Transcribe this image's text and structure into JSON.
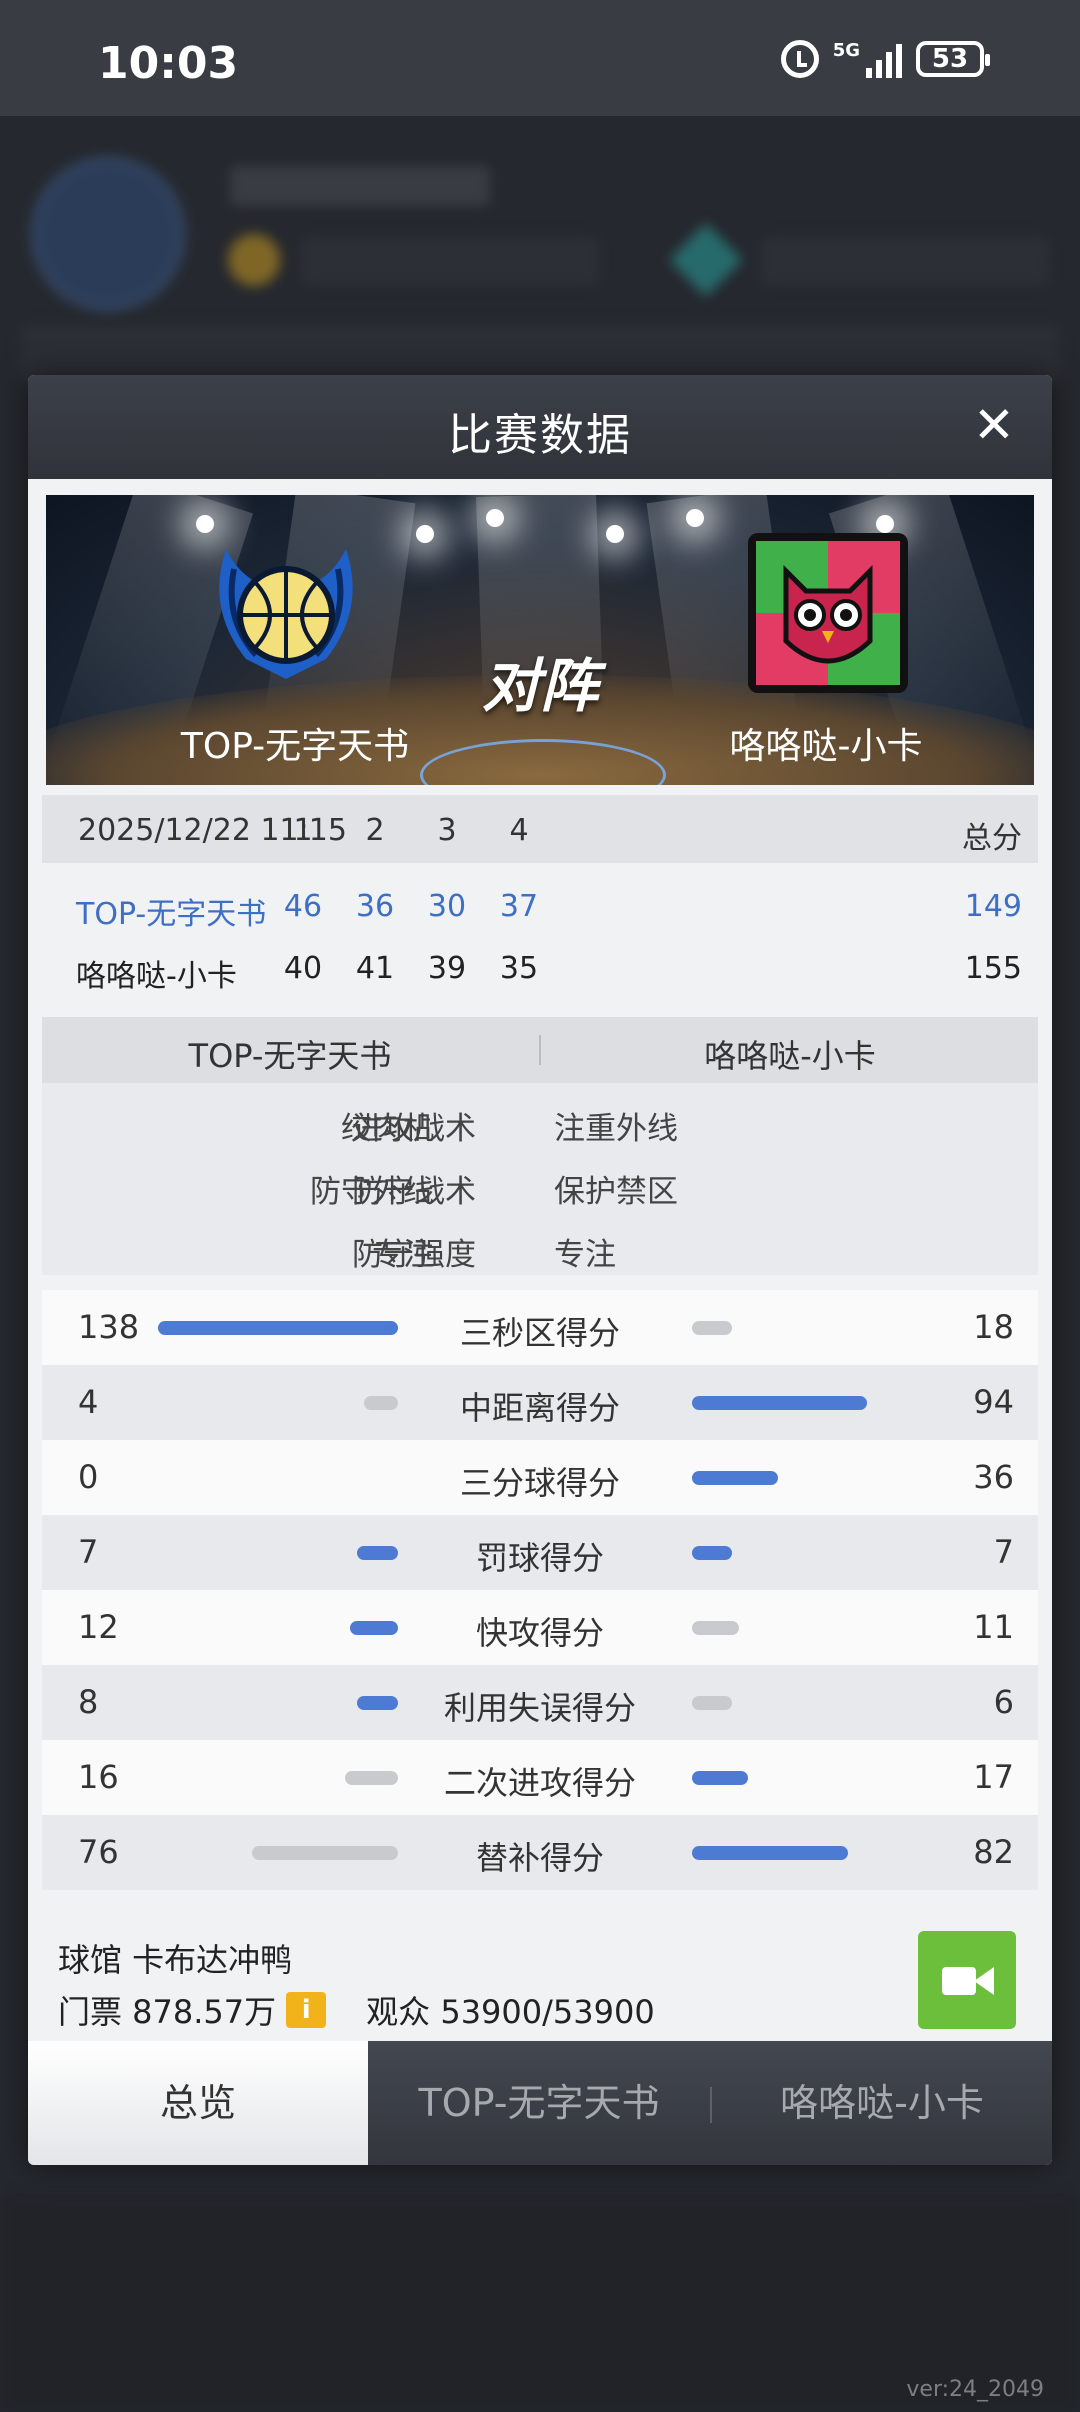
{
  "status_bar": {
    "time": "10:03",
    "network": "5G",
    "battery": "53"
  },
  "version": "ver:24_2049",
  "modal": {
    "title": "比赛数据",
    "close": "✕",
    "vs_label": "对阵",
    "home_team": "TOP-无字天书",
    "away_team": "咯咯哒-小卡",
    "score_table": {
      "datetime": "2025/12/22 11:15",
      "quarters": [
        "1",
        "2",
        "3",
        "4"
      ],
      "total_label": "总分",
      "home": {
        "name": "TOP-无字天书",
        "quarters": [
          "46",
          "36",
          "30",
          "37"
        ],
        "total": "149"
      },
      "away": {
        "name": "咯咯哒-小卡",
        "quarters": [
          "40",
          "41",
          "39",
          "35"
        ],
        "total": "155"
      }
    },
    "tactics": {
      "home": [
        "绞肉机",
        "防守外线",
        "专注"
      ],
      "labels": [
        "进攻战术",
        "防守战术",
        "防守强度"
      ],
      "away": [
        "注重外线",
        "保护禁区",
        "专注"
      ]
    },
    "stats": [
      {
        "label": "三秒区得分",
        "home": "138",
        "away": "18",
        "home_frac": 1.0,
        "away_frac": 0.23,
        "home_hl": true,
        "away_hl": false
      },
      {
        "label": "中距离得分",
        "home": "4",
        "away": "94",
        "home_frac": 0.14,
        "away_frac": 1.0,
        "home_hl": false,
        "away_hl": true
      },
      {
        "label": "三分球得分",
        "home": "0",
        "away": "36",
        "home_frac": 0.0,
        "away_frac": 0.49,
        "home_hl": false,
        "away_hl": true
      },
      {
        "label": "罚球得分",
        "home": "7",
        "away": "7",
        "home_frac": 0.17,
        "away_frac": 0.23,
        "home_hl": true,
        "away_hl": true
      },
      {
        "label": "快攻得分",
        "home": "12",
        "away": "11",
        "home_frac": 0.2,
        "away_frac": 0.27,
        "home_hl": true,
        "away_hl": false
      },
      {
        "label": "利用失误得分",
        "home": "8",
        "away": "6",
        "home_frac": 0.17,
        "away_frac": 0.23,
        "home_hl": true,
        "away_hl": false
      },
      {
        "label": "二次进攻得分",
        "home": "16",
        "away": "17",
        "home_frac": 0.22,
        "away_frac": 0.32,
        "home_hl": false,
        "away_hl": true
      },
      {
        "label": "替补得分",
        "home": "76",
        "away": "82",
        "home_frac": 0.61,
        "away_frac": 0.89,
        "home_hl": false,
        "away_hl": true
      }
    ],
    "venue": "球馆 卡布达冲鸭",
    "ticket": "门票 878.57万",
    "audience": "观众 53900/53900",
    "tabs": [
      "总览",
      "TOP-无字天书",
      "咯咯哒-小卡"
    ]
  },
  "colors": {
    "accent_blue": "#4d7bd4",
    "bar_grey": "#c9cacd",
    "video_green": "#6bbf3a",
    "info_orange": "#f2b21a"
  }
}
